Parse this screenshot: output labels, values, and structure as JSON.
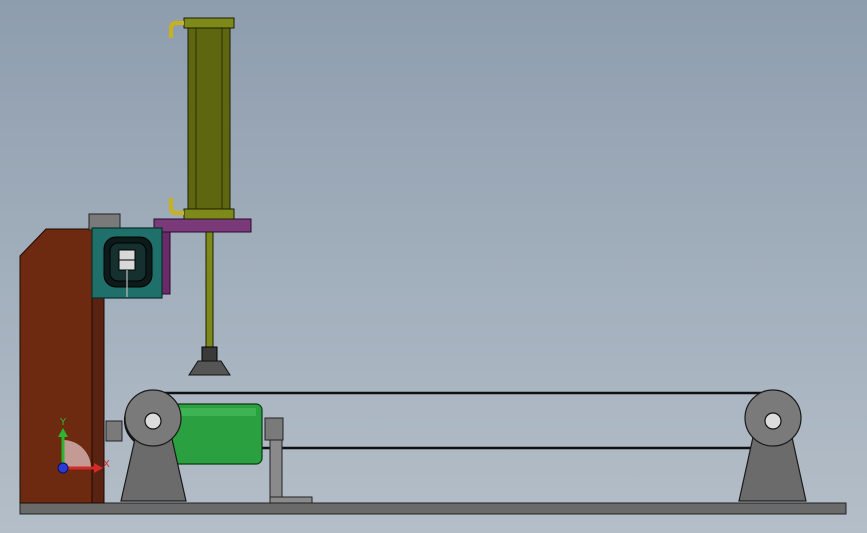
{
  "triad": {
    "y_label": "Y",
    "x_label": "X",
    "y_color": "#2db52d",
    "x_color": "#d42a2a",
    "z_color": "#2a3bd4"
  },
  "colors": {
    "cylinder": "#5e6610",
    "cylinder_cap": "#7d8a1a",
    "hose": "#c8b21a",
    "mount_plate": "#7a3a7a",
    "frame": "#6e2a10",
    "motor_box": "#1f6f6a",
    "conveyor_roller": "#2aa040",
    "support": "#6b6b6b",
    "base": "#6a6a6a"
  }
}
